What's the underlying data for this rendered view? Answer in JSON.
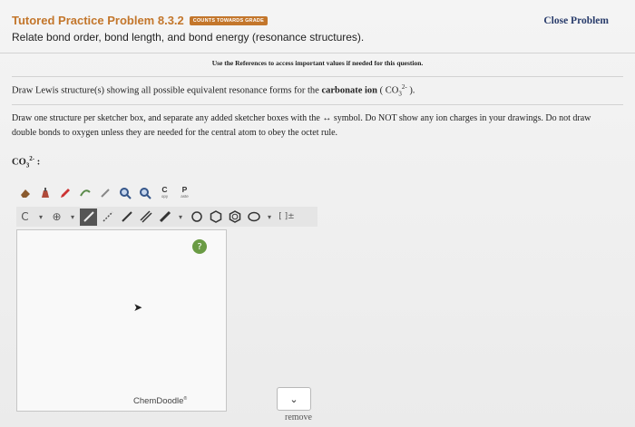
{
  "header": {
    "title": "Tutored Practice Problem 8.3.2",
    "badge": "COUNTS TOWARDS GRADE",
    "subtitle": "Relate bond order, bond length, and bond energy (resonance structures).",
    "close": "Close Problem"
  },
  "refs": "Use the References to access important values if needed for this question.",
  "question": {
    "line1_prefix": "Draw Lewis structure(s) showing all possible equivalent resonance forms for the ",
    "line1_bold": "carbonate ion",
    "line1_formula_open": " ( CO",
    "line1_sub": "3",
    "line1_sup": "2-",
    "line1_close": " ).",
    "line2": "Draw one structure per sketcher box, and separate any added sketcher boxes with the ↔ symbol. Do NOT show any ion charges in your drawings. Do not draw double bonds to oxygen unless they are needed for the central atom to obey the octet rule."
  },
  "formula_label": {
    "base": "CO",
    "sub": "3",
    "sup": "2-",
    "suffix": " :"
  },
  "toolbar": {
    "copy_letter": "C",
    "copy_label": "opy",
    "paste_letter": "P",
    "paste_label": "aste",
    "charge_label": "C",
    "bracket_label": "[ ]±"
  },
  "canvas": {
    "brand": "ChemDoodle",
    "brand_mark": "®",
    "help": "?"
  },
  "remove": "remove",
  "icons": [
    "eraser-icon",
    "cleanup-icon",
    "lasso-icon",
    "zoom-in-icon",
    "zoom-out-icon",
    "plus-circle-icon",
    "bond-icon",
    "ring-icon",
    "arrow-icon"
  ]
}
